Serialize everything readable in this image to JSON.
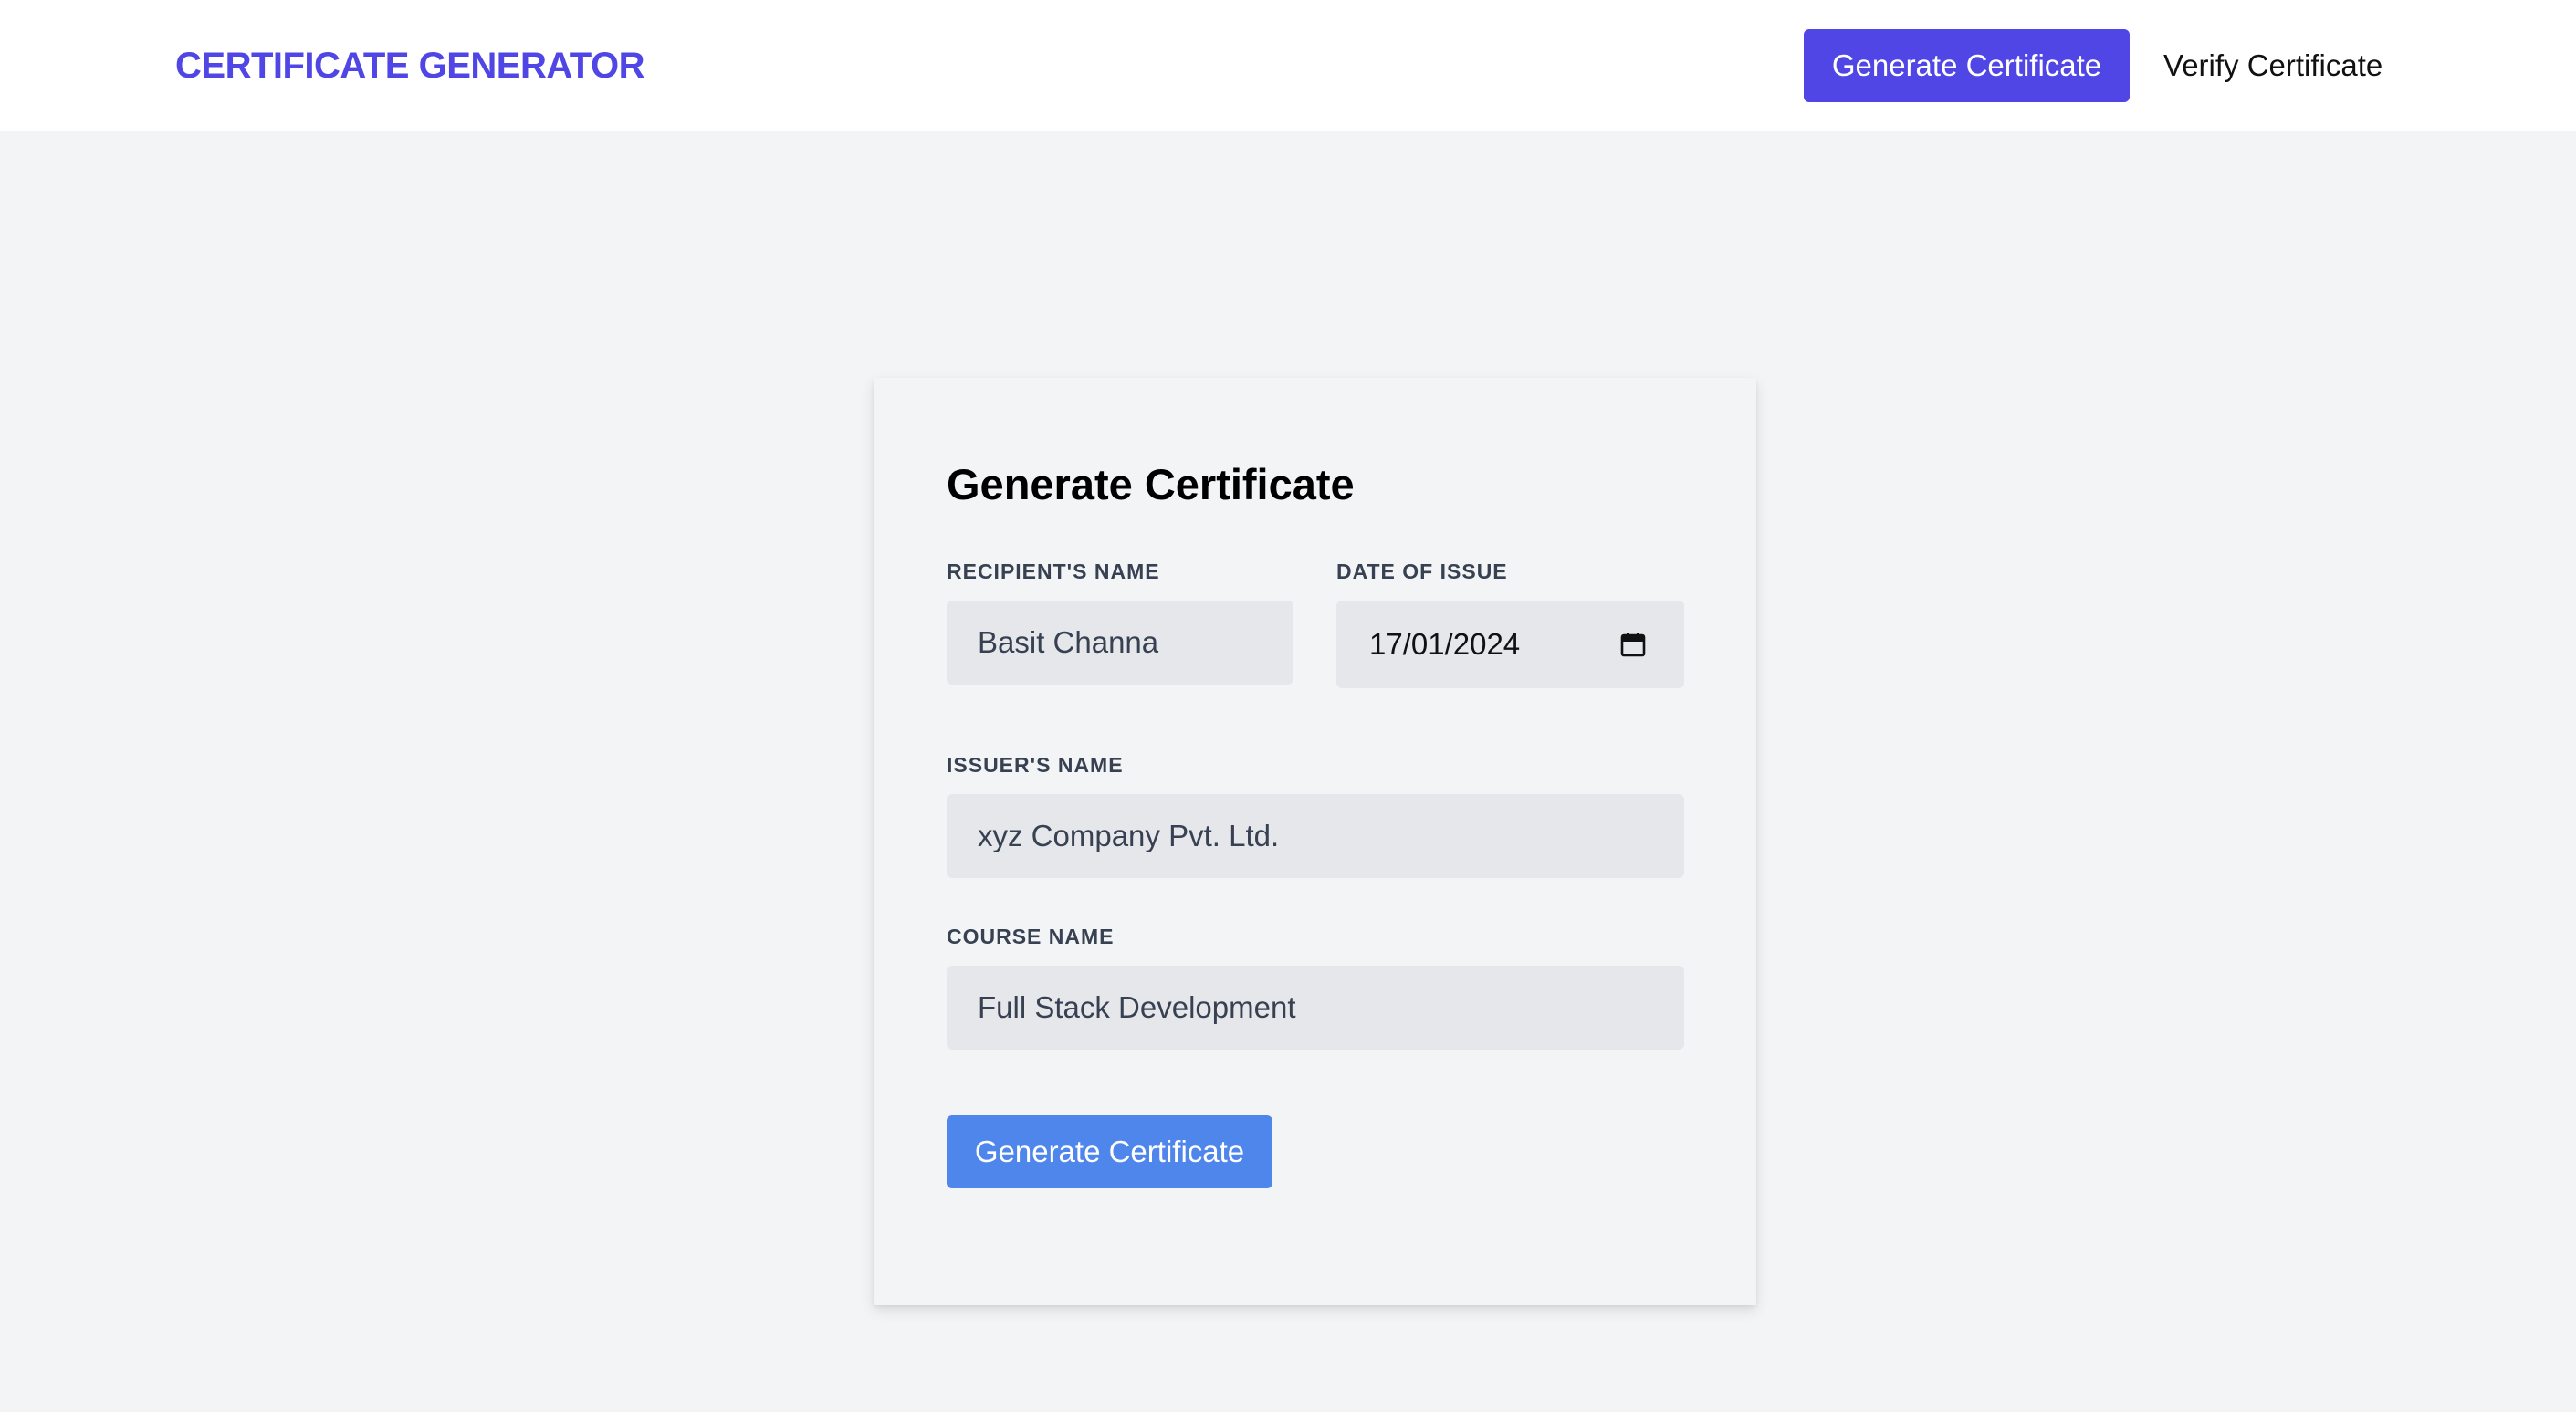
{
  "header": {
    "brand": "CERTIFICATE GENERATOR",
    "nav_generate_label": "Generate Certificate",
    "nav_verify_label": "Verify Certificate"
  },
  "form": {
    "title": "Generate Certificate",
    "recipient": {
      "label": "RECIPIENT'S NAME",
      "value": "Basit Channa"
    },
    "date": {
      "label": "DATE OF ISSUE",
      "value": "17/01/2024",
      "icon": "calendar-icon"
    },
    "issuer": {
      "label": "ISSUER'S NAME",
      "value": "xyz Company Pvt. Ltd."
    },
    "course": {
      "label": "COURSE NAME",
      "value": "Full Stack Development"
    },
    "submit_label": "Generate Certificate"
  },
  "colors": {
    "brand": "#4f46e5",
    "submit_button": "#4f86ec",
    "page_background": "#f3f4f6",
    "input_background": "#e5e7eb"
  }
}
